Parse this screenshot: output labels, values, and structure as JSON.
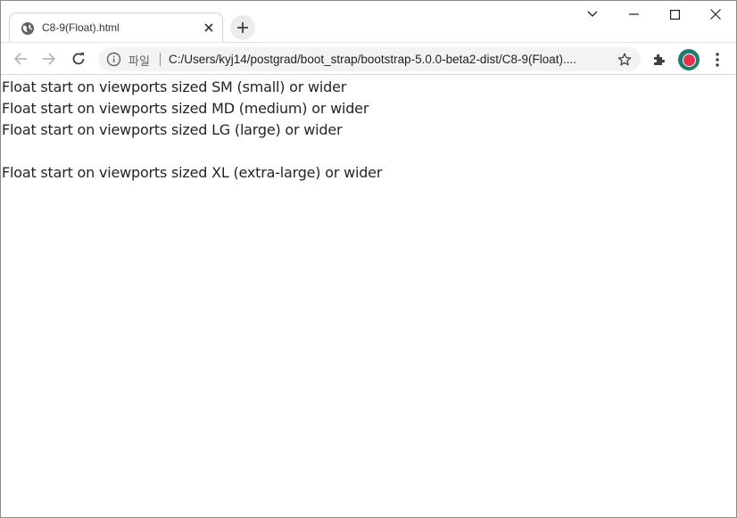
{
  "browser": {
    "tab": {
      "title": "C8-9(Float).html",
      "favicon": "globe-icon"
    },
    "window_controls": [
      "chevron-down-icon",
      "minimize-icon",
      "maximize-icon",
      "close-icon"
    ],
    "omnibox": {
      "site_label": "파일",
      "url": "C:/Users/kyj14/postgrad/boot_strap/bootstrap-5.0.0-beta2-dist/C8-9(Float)...."
    },
    "profile_color": "#e2324c"
  },
  "page": {
    "lines": [
      "Float start on viewports sized SM (small) or wider",
      "Float start on viewports sized MD (medium) or wider",
      "Float start on viewports sized LG (large) or wider",
      "Float start on viewports sized XL (extra-large) or wider"
    ]
  }
}
